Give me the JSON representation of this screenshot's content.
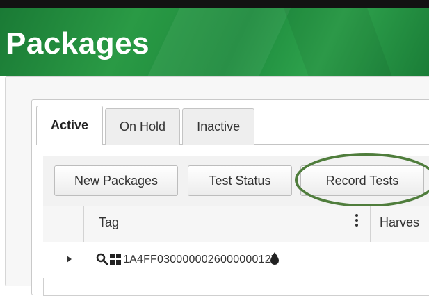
{
  "page": {
    "title": "Packages"
  },
  "tabs": [
    {
      "label": "Active",
      "active": true
    },
    {
      "label": "On Hold",
      "active": false
    },
    {
      "label": "Inactive",
      "active": false
    }
  ],
  "toolbar": {
    "new_packages_label": "New Packages",
    "test_status_label": "Test Status",
    "record_tests_label": "Record Tests"
  },
  "grid": {
    "columns": [
      {
        "label": "Tag"
      },
      {
        "label": "Harves"
      }
    ],
    "rows": [
      {
        "tag": "1A4FF0300000026000000127"
      }
    ]
  },
  "colors": {
    "header_green": "#1f8a3c",
    "annotation_circle": "#4f7d3c"
  },
  "icons": [
    "search-icon",
    "grid-icon",
    "drop-icon",
    "kebab-menu-icon",
    "expand-arrow-icon"
  ]
}
